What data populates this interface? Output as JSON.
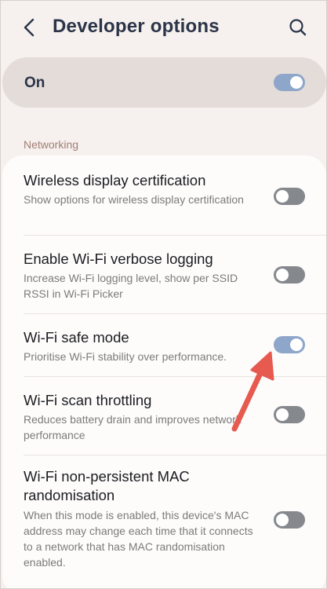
{
  "header": {
    "title": "Developer options"
  },
  "master_switch": {
    "label": "On",
    "state": "on"
  },
  "section": {
    "label": "Networking"
  },
  "settings": [
    {
      "title": "Wireless display certification",
      "description": "Show options for wireless display certification",
      "state": "off"
    },
    {
      "title": "Enable Wi-Fi verbose logging",
      "description": "Increase Wi-Fi logging level, show per SSID RSSI in Wi-Fi Picker",
      "state": "off"
    },
    {
      "title": "Wi-Fi safe mode",
      "description": "Prioritise Wi-Fi stability over performance.",
      "state": "on"
    },
    {
      "title": "Wi-Fi scan throttling",
      "description": "Reduces battery drain and improves network performance",
      "state": "off"
    },
    {
      "title": "Wi-Fi non-persistent MAC randomisation",
      "description": "When this mode is enabled, this device's MAC address may change each time that it connects to a network that has MAC randomisation enabled.",
      "state": "off"
    }
  ],
  "colors": {
    "toggle_on": "#8ea6c9",
    "toggle_off": "#85888d",
    "accent_arrow": "#e65a4f",
    "section_label": "#a27e74"
  },
  "icons": {
    "back": "chevron-left-icon",
    "search": "search-icon",
    "annotation": "red-arrow-icon"
  }
}
